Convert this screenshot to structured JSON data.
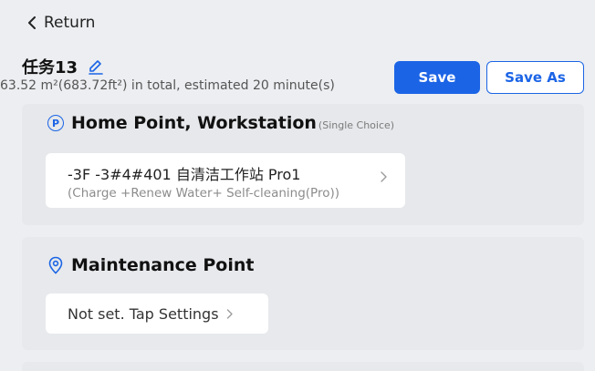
{
  "nav": {
    "back_label": "Return"
  },
  "task": {
    "name": "任务13",
    "summary": "63.52 m²(683.72ft²) in total, estimated 20 minute(s)"
  },
  "actions": {
    "save_label": "Save",
    "save_as_label": "Save As"
  },
  "home_section": {
    "icon": "parking-p-icon",
    "title": "Home Point, Workstation",
    "hint": "(Single Choice)",
    "item": {
      "line1": "-3F   -3#4#401   自清洁工作站 Pro1",
      "line2": "(Charge +Renew Water+ Self-cleaning(Pro))"
    }
  },
  "maintenance_section": {
    "icon": "location-pin-icon",
    "title": "Maintenance Point",
    "item": {
      "label": "Not set. Tap Settings"
    }
  },
  "colors": {
    "accent": "#1b64e6",
    "background": "#eceef1",
    "card": "#e7e9ec",
    "item": "#ffffff"
  }
}
